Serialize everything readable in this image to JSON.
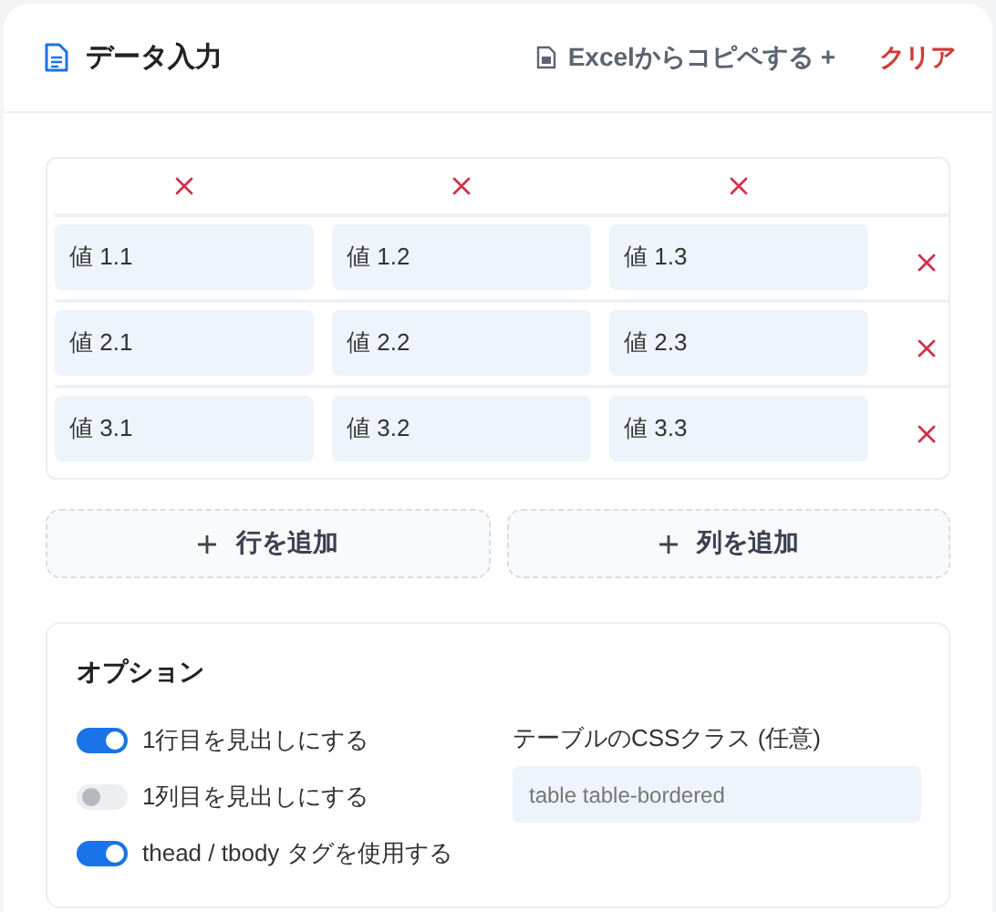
{
  "header": {
    "title": "データ入力",
    "paste_button": "Excelからコピペする +",
    "clear_button": "クリア"
  },
  "table": {
    "rows": [
      {
        "cells": [
          "値 1.1",
          "値 1.2",
          "値 1.3"
        ]
      },
      {
        "cells": [
          "値 2.1",
          "値 2.2",
          "値 2.3"
        ]
      },
      {
        "cells": [
          "値 3.1",
          "値 3.2",
          "値 3.3"
        ]
      }
    ]
  },
  "add_row_button": "行を追加",
  "add_column_button": "列を追加",
  "options": {
    "title": "オプション",
    "toggles": [
      {
        "label": "1行目を見出しにする",
        "on": true
      },
      {
        "label": "1列目を見出しにする",
        "on": false
      },
      {
        "label": "thead / tbody タグを使用する",
        "on": true
      }
    ],
    "css_class": {
      "label": "テーブルのCSSクラス (任意)",
      "placeholder": "table table-bordered"
    }
  }
}
